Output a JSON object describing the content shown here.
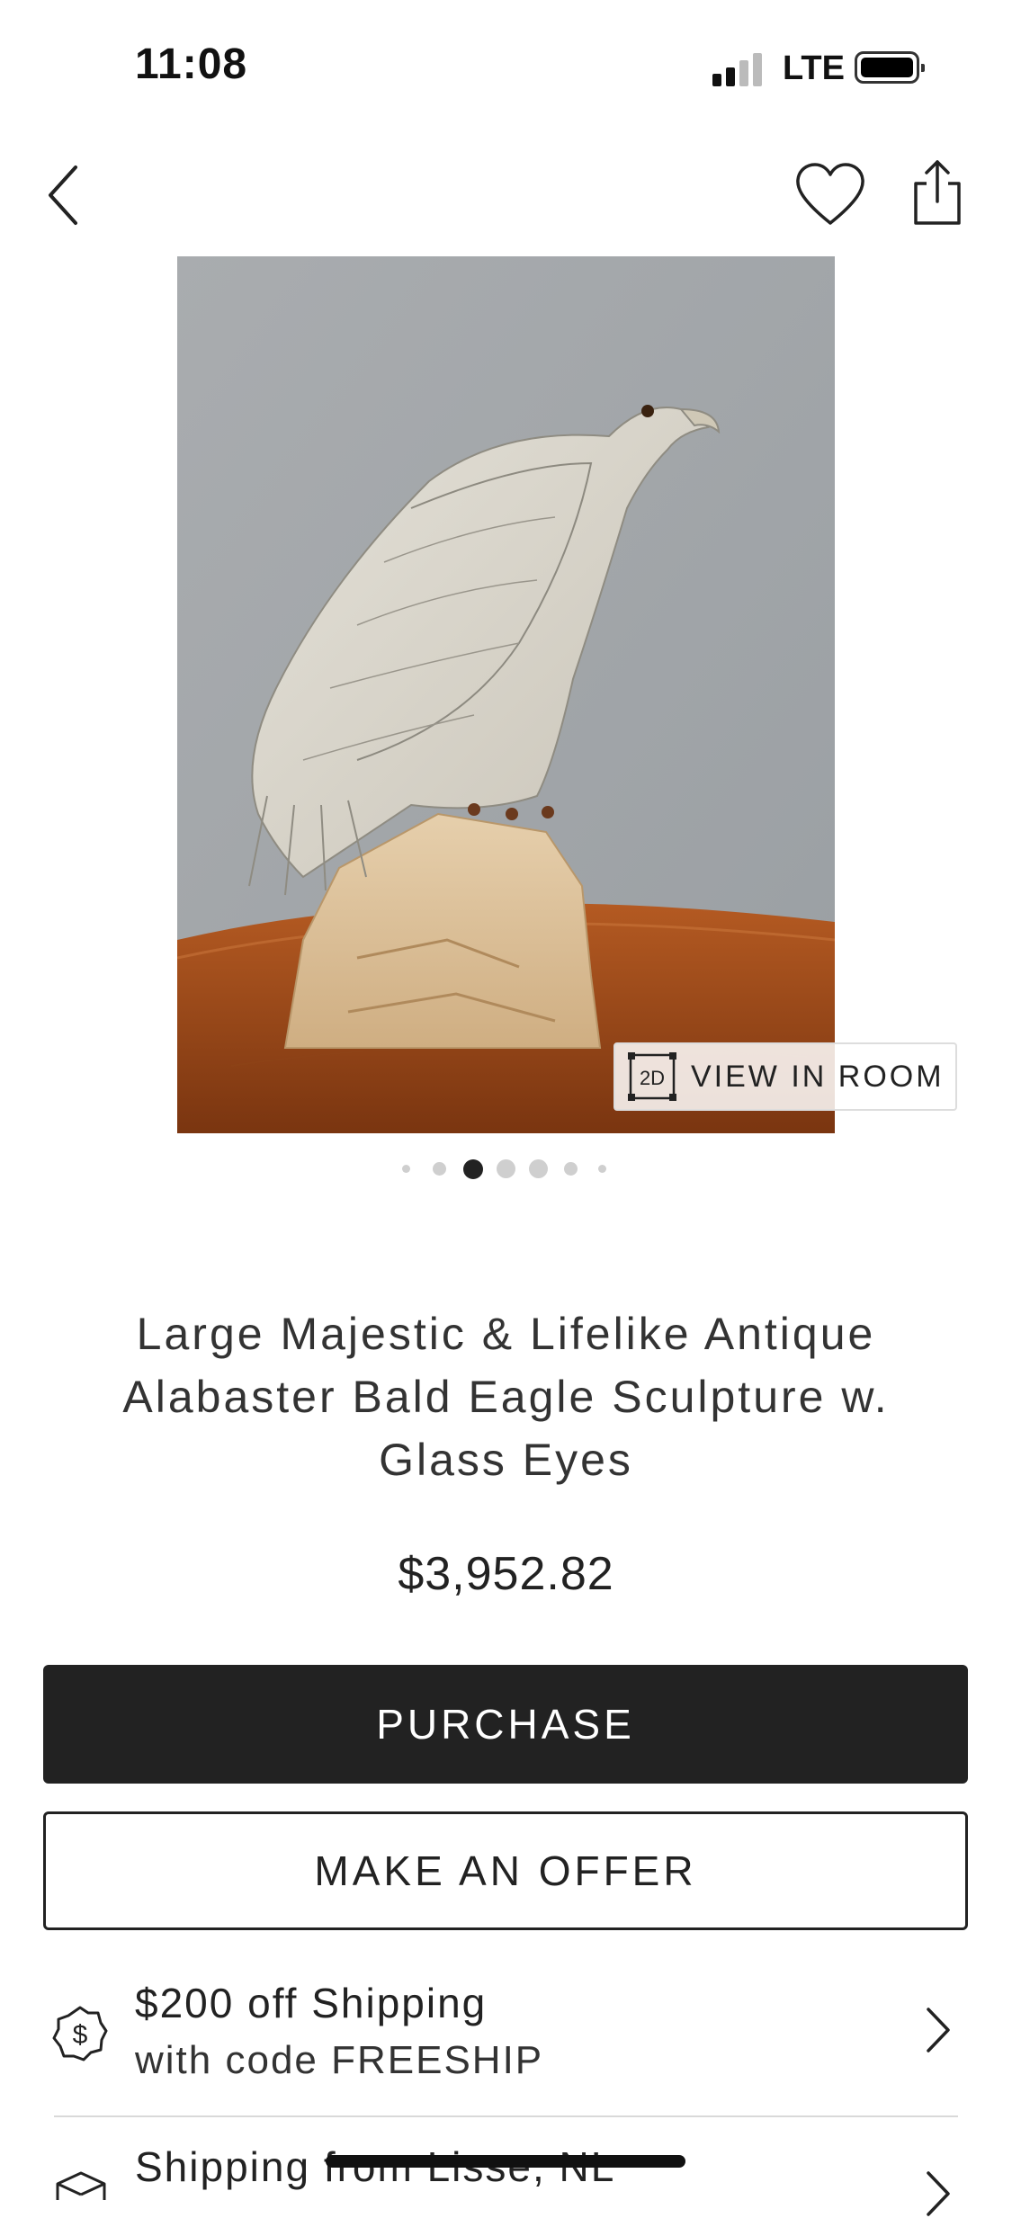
{
  "status_bar": {
    "time": "11:08",
    "network": "LTE"
  },
  "nav": {
    "back_icon": "chevron-left-icon",
    "favorite_icon": "heart-icon",
    "share_icon": "share-icon"
  },
  "product": {
    "image_alt": "Alabaster bald eagle sculpture on a wooden table",
    "view_in_room_badge": "2D",
    "view_in_room_label": "VIEW IN ROOM",
    "carousel": {
      "count": 7,
      "active_index": 2
    },
    "title": "Large Majestic & Lifelike Antique Alabaster Bald Eagle Sculpture w. Glass Eyes",
    "price": "$3,952.82"
  },
  "actions": {
    "purchase_label": "PURCHASE",
    "offer_label": "MAKE AN OFFER"
  },
  "promo": {
    "icon": "dollar-badge-icon",
    "line1": "$200 off Shipping",
    "line2": "with code FREESHIP"
  },
  "shipping": {
    "icon": "package-icon",
    "label": "Shipping from Lisse, NL"
  },
  "colors": {
    "primary": "#222222",
    "background": "#ffffff",
    "divider": "#d9d9d9"
  }
}
